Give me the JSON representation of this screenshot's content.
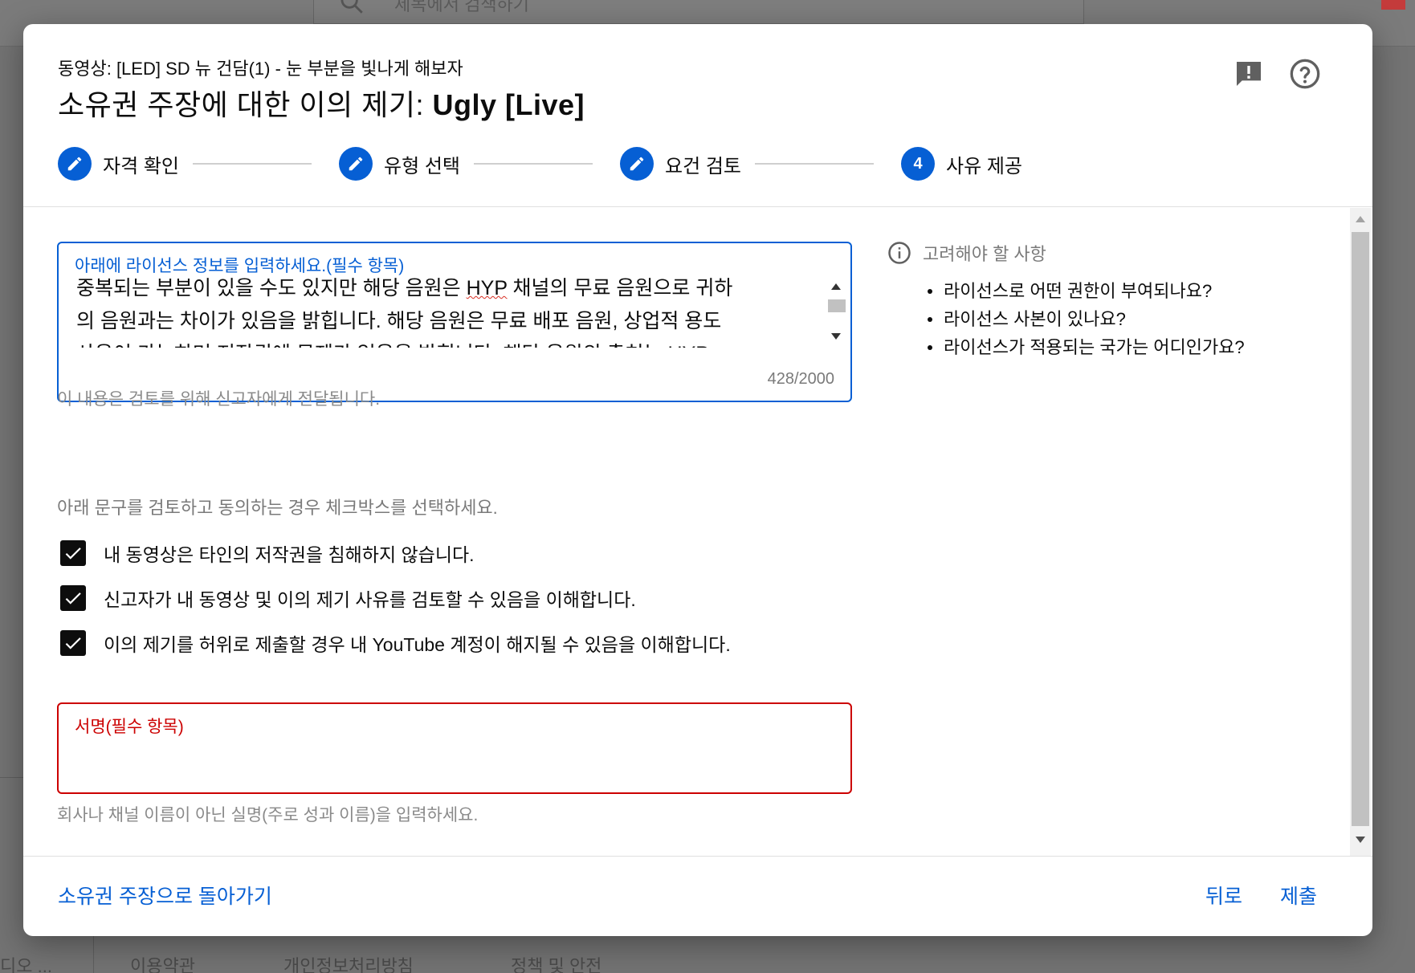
{
  "background": {
    "search_placeholder": "제목에서 검색하기",
    "footer_links": [
      "이용약관",
      "개인정보처리방침",
      "정책 및 안전"
    ],
    "left_truncated": "디오 ..."
  },
  "dialog": {
    "subtitle": "동영상: [LED] SD 뉴 건담(1) - 눈 부분을 빛나게 해보자",
    "title_prefix": "소유권 주장에 대한 이의 제기: ",
    "title_bold": "Ugly [Live]",
    "icons": {
      "feedback": "feedback-icon",
      "help": "help-icon"
    },
    "steps": [
      {
        "label": "자격 확인",
        "state": "edit"
      },
      {
        "label": "유형 선택",
        "state": "edit"
      },
      {
        "label": "요건 검토",
        "state": "edit"
      },
      {
        "label": "사유 제공",
        "state": "current",
        "number": "4"
      }
    ],
    "license_field": {
      "label": "아래에 라이선스 정보를 입력하세요.(필수 항목)",
      "text_line1_a": "중복되는 부분이 있을 수도 있지만 해당 음원은 ",
      "text_line1_spell": "HYP",
      "text_line1_b": " 채널의 무료 음원으로 귀하",
      "text_line2": "의 음원과는 차이가 있음을 밝힙니다. 해당 음원은 무료 배포 음원, 상업적 용도",
      "text_line3": "사용이 가능하며 저작권에 문제가 없음을 밝힙니다. 해당 음원의 출처는 HYP",
      "counter": "428/2000",
      "helper": "이 내용은 검토를 위해 신고자에게 전달됩니다."
    },
    "instructions": "아래 문구를 검토하고 동의하는 경우 체크박스를 선택하세요.",
    "checkboxes": [
      {
        "label": "내 동영상은 타인의 저작권을 침해하지 않습니다.",
        "checked": true
      },
      {
        "label": "신고자가 내 동영상 및 이의 제기 사유를 검토할 수 있음을 이해합니다.",
        "checked": true
      },
      {
        "label": "이의 제기를 허위로 제출할 경우 내 YouTube 계정이 해지될 수 있음을 이해합니다.",
        "checked": true
      }
    ],
    "signature_field": {
      "label": "서명(필수 항목)",
      "helper": "회사나 채널 이름이 아닌 실명(주로 성과 이름)을 입력하세요."
    },
    "considerations": {
      "heading": "고려해야 할 사항",
      "items": [
        "라이선스로 어떤 권한이 부여되나요?",
        "라이선스 사본이 있나요?",
        "라이선스가 적용되는 국가는 어디인가요?"
      ]
    },
    "footer": {
      "back_to_claim": "소유권 주장으로 돌아가기",
      "back": "뒤로",
      "submit": "제출"
    }
  },
  "colors": {
    "accent": "#065fd4",
    "error": "#cc0000"
  }
}
